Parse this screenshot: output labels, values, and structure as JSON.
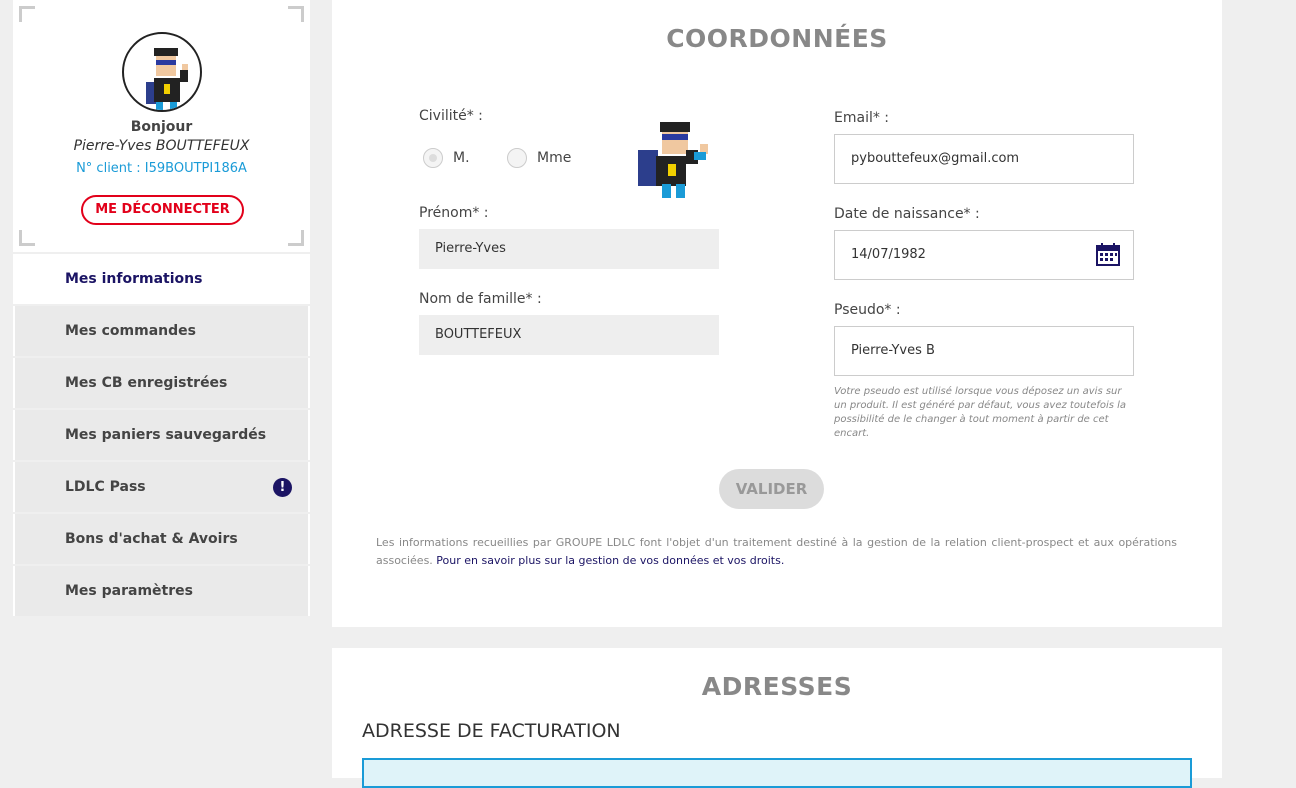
{
  "profile": {
    "greeting": "Bonjour",
    "name": "Pierre-Yves BOUTTEFEUX",
    "client_number": "N° client : I59BOUTPI186A",
    "logout_label": "ME DÉCONNECTER"
  },
  "menu": {
    "items": [
      {
        "label": "Mes informations"
      },
      {
        "label": "Mes commandes"
      },
      {
        "label": "Mes CB enregistrées"
      },
      {
        "label": "Mes paniers sauvegardés"
      },
      {
        "label": "LDLC Pass"
      },
      {
        "label": "Bons d'achat & Avoirs"
      },
      {
        "label": "Mes paramètres"
      }
    ],
    "badge": "!"
  },
  "coordonnees": {
    "title": "COORDONNÉES",
    "civilite_label": "Civilité* :",
    "civilite_options": [
      "M.",
      "Mme"
    ],
    "prenom_label": "Prénom* :",
    "prenom_value": "Pierre-Yves",
    "nom_label": "Nom de famille* :",
    "nom_value": "BOUTTEFEUX",
    "email_label": "Email* :",
    "email_value": "pybouttefeux@gmail.com",
    "naissance_label": "Date de naissance* :",
    "naissance_value": "14/07/1982",
    "pseudo_label": "Pseudo* :",
    "pseudo_value": "Pierre-Yves B",
    "pseudo_hint": "Votre pseudo est utilisé lorsque vous déposez un avis sur un produit. Il est généré par défaut, vous avez toutefois la possibilité de le changer à tout moment à partir de cet encart.",
    "validate_label": "VALIDER",
    "legal_text": "Les informations recueillies par GROUPE LDLC font l'objet d'un traitement destiné à la gestion de la relation client-prospect et aux opérations associées. ",
    "legal_link": "Pour en savoir plus sur la gestion de vos données et vos droits."
  },
  "adresses": {
    "title": "ADRESSES",
    "subtitle": "ADRESSE DE FACTURATION"
  },
  "colors": {
    "accent": "#1b1464",
    "logout": "#e2001a",
    "client": "#1a9bd7"
  }
}
